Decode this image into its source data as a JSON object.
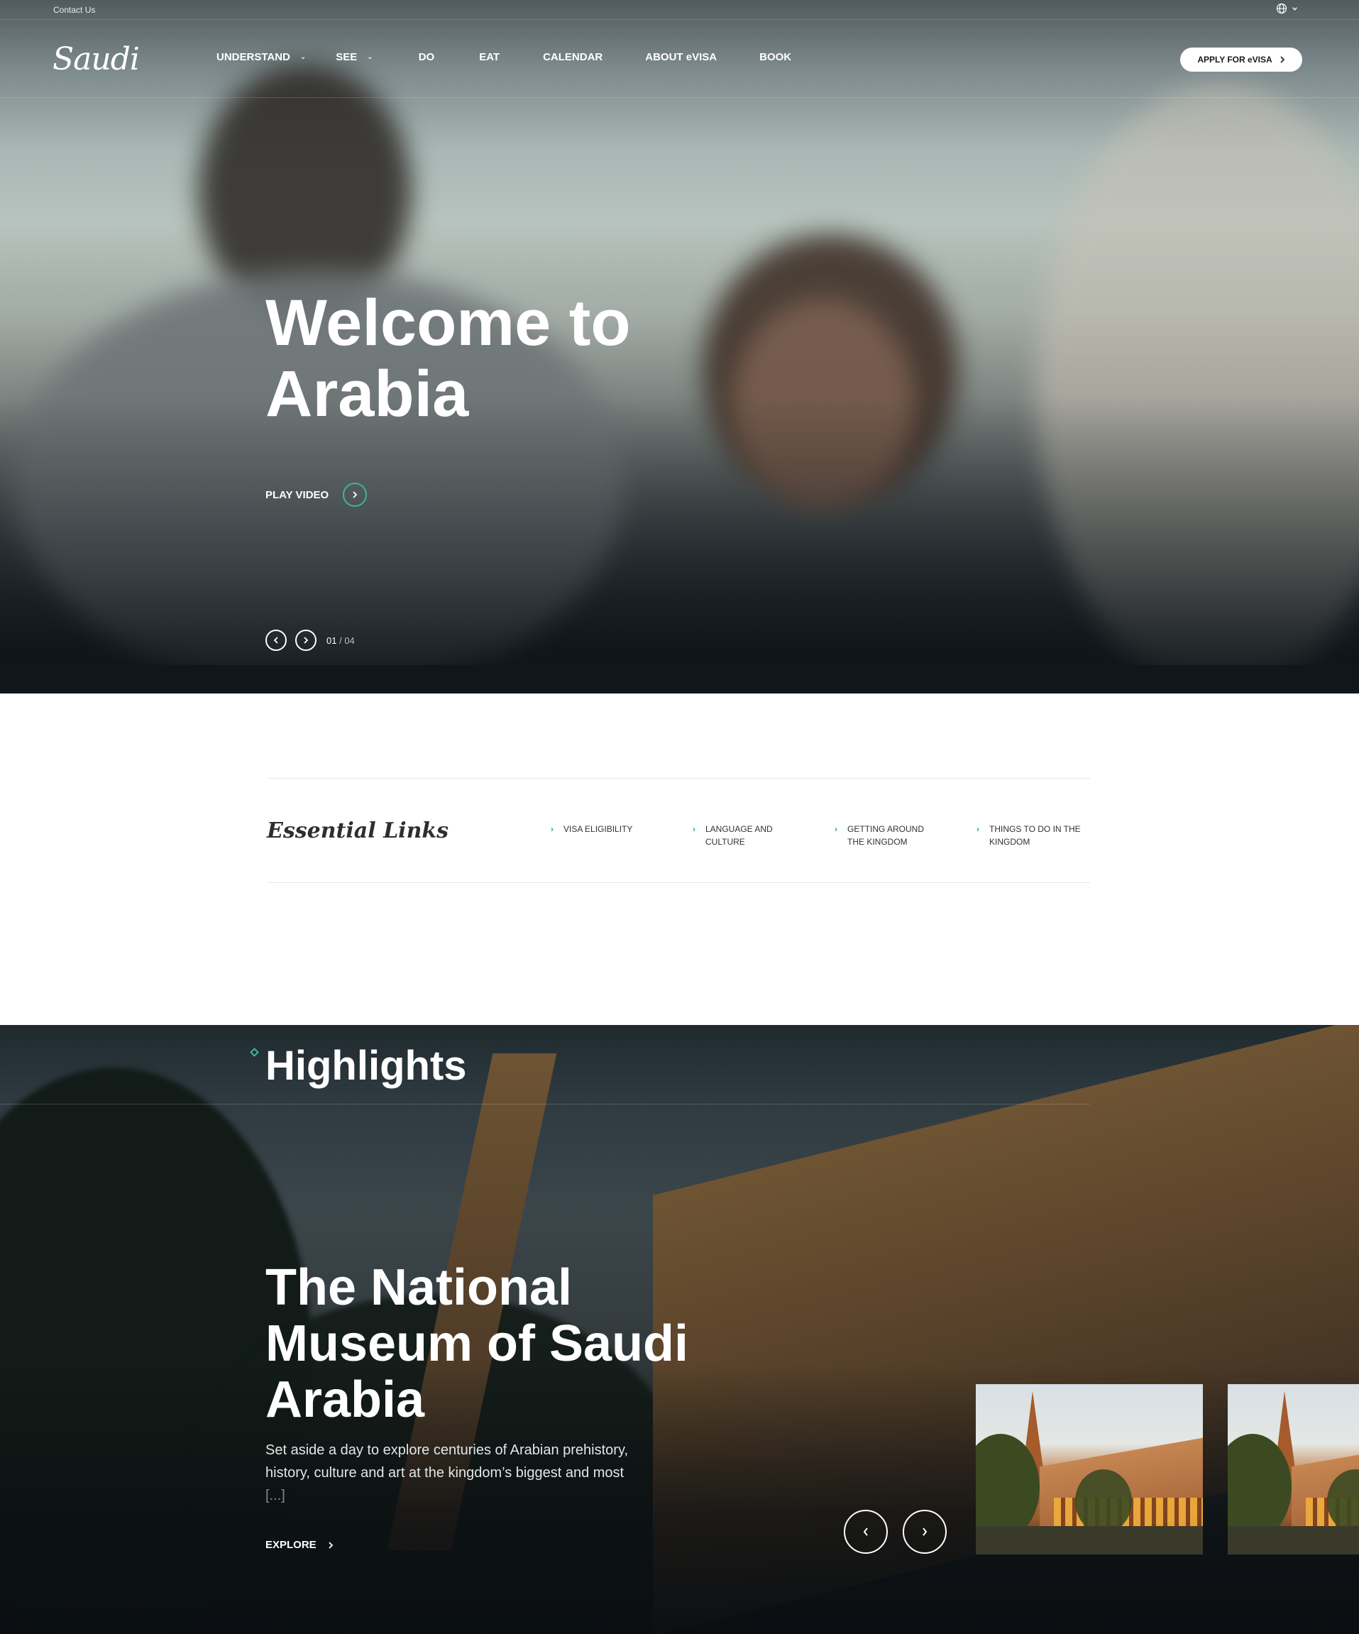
{
  "topbar": {
    "contact_label": "Contact Us",
    "language_icon": "globe-icon"
  },
  "brand": {
    "logo_text": "Saudi"
  },
  "nav": {
    "items": [
      {
        "label": "UNDERSTAND",
        "has_dropdown": true
      },
      {
        "label": "SEE",
        "has_dropdown": true
      },
      {
        "label": "DO",
        "has_dropdown": false
      },
      {
        "label": "EAT",
        "has_dropdown": false
      },
      {
        "label": "CALENDAR",
        "has_dropdown": false
      },
      {
        "label": "ABOUT eVISA",
        "has_dropdown": false
      },
      {
        "label": "BOOK",
        "has_dropdown": false
      }
    ],
    "apply_button": "APPLY FOR eVISA"
  },
  "hero": {
    "title": "Welcome to Arabia",
    "play_label": "PLAY VIDEO",
    "pager_current": "01",
    "pager_total": "/ 04"
  },
  "essential_links": {
    "title": "Essential Links",
    "links": [
      "VISA ELIGIBILITY",
      "LANGUAGE AND CULTURE",
      "GETTING AROUND THE KINGDOM",
      "THINGS TO DO IN THE KINGDOM"
    ]
  },
  "highlights": {
    "title": "Highlights",
    "feature_title": "The National Museum of Saudi Arabia",
    "feature_description": "Set aside a day to explore centuries of Arabian prehistory, history, culture and art at the kingdom’s biggest and most",
    "feature_more": "[...]",
    "explore_label": "EXPLORE"
  },
  "colors": {
    "accent": "#3fb59a",
    "link_chevron": "#2aa58a",
    "text_dark": "#2d3436"
  }
}
